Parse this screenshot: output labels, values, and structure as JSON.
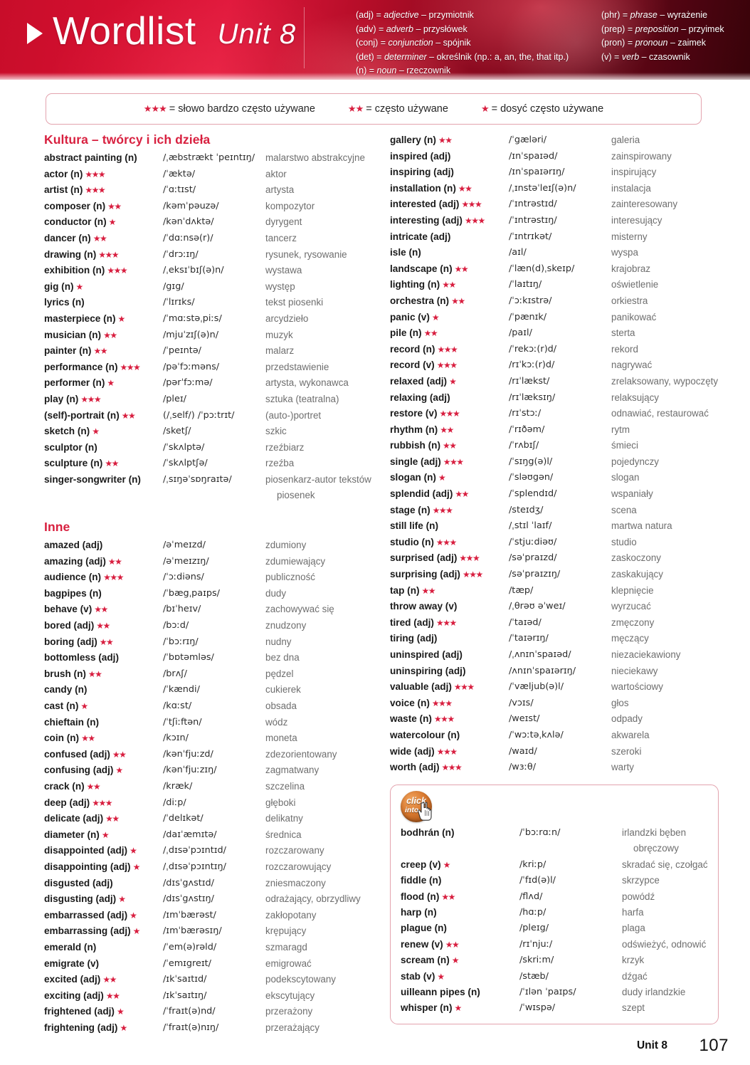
{
  "header": {
    "title": "Wordlist",
    "unit": "Unit 8",
    "arrow_icon": "triangle-right-icon",
    "abbreviations_left": [
      "(adj) = adjective – przymiotnik",
      "(adv) = adverb – przysłówek",
      "(conj) = conjunction – spójnik",
      "(det) = determiner – określnik (np.: a, an, the, that itp.)",
      "(n) = noun – rzeczownik"
    ],
    "abbreviations_right": [
      "(phr) = phrase – wyrażenie",
      "(prep) = preposition – przyimek",
      "(pron) = pronoun – zaimek",
      "(v) = verb – czasownik"
    ],
    "abbreviations_left_parts": [
      {
        "abbr": "(adj) = ",
        "italic": "adjective",
        "rest": " – przymiotnik"
      },
      {
        "abbr": "(adv) = ",
        "italic": "adverb",
        "rest": " – przysłówek"
      },
      {
        "abbr": "(conj) = ",
        "italic": "conjunction",
        "rest": " – spójnik"
      },
      {
        "abbr": "(det) = ",
        "italic": "determiner",
        "rest": " – określnik (np.: a, an, the, that itp.)"
      },
      {
        "abbr": "(n) = ",
        "italic": "noun",
        "rest": " – rzeczownik"
      }
    ],
    "abbreviations_right_parts": [
      {
        "abbr": "(phr) = ",
        "italic": "phrase",
        "rest": " – wyrażenie"
      },
      {
        "abbr": "(prep) = ",
        "italic": "preposition",
        "rest": " – przyimek"
      },
      {
        "abbr": "(pron) = ",
        "italic": "pronoun",
        "rest": " – zaimek"
      },
      {
        "abbr": "(v) = ",
        "italic": "verb",
        "rest": " – czasownik"
      }
    ]
  },
  "legend": {
    "items": [
      {
        "stars": "★★★",
        "text": "= słowo bardzo często używane"
      },
      {
        "stars": "★★",
        "text": "= często używane"
      },
      {
        "stars": "★",
        "text": "= dosyć często używane"
      }
    ]
  },
  "colors": {
    "accent_red": "#d8203f",
    "star_red": "#d81e3f",
    "header_red": "#c80d2a",
    "translation_grey": "#6e6e6e",
    "box_border": "#e3a3ae",
    "badge_orange": "#d9792f"
  },
  "sections": {
    "kultura": {
      "title": "Kultura – twórcy i ich dzieła",
      "entries": [
        {
          "word": "abstract painting (n)",
          "stars": "",
          "ipa": "/ˌæbstrækt ˈpeɪntɪŋ/",
          "pl": "malarstwo abstrakcyjne"
        },
        {
          "word": "actor (n)",
          "stars": "★★★",
          "ipa": "/ˈæktə/",
          "pl": "aktor"
        },
        {
          "word": "artist (n)",
          "stars": "★★★",
          "ipa": "/ˈɑːtɪst/",
          "pl": "artysta"
        },
        {
          "word": "composer (n)",
          "stars": "★★",
          "ipa": "/kəmˈpəuzə/",
          "pl": "kompozytor"
        },
        {
          "word": "conductor (n)",
          "stars": "★",
          "ipa": "/kənˈdʌktə/",
          "pl": "dyrygent"
        },
        {
          "word": "dancer (n)",
          "stars": "★★",
          "ipa": "/ˈdɑːnsə(r)/",
          "pl": "tancerz"
        },
        {
          "word": "drawing (n)",
          "stars": "★★★",
          "ipa": "/ˈdrɔːɪŋ/",
          "pl": "rysunek, rysowanie"
        },
        {
          "word": "exhibition (n)",
          "stars": "★★★",
          "ipa": "/ˌeksɪˈbɪʃ(ə)n/",
          "pl": "wystawa"
        },
        {
          "word": "gig (n)",
          "stars": "★",
          "ipa": "/gɪg/",
          "pl": "występ"
        },
        {
          "word": "lyrics (n)",
          "stars": "",
          "ipa": "/ˈlɪrɪks/",
          "pl": "tekst piosenki"
        },
        {
          "word": "masterpiece (n)",
          "stars": "★",
          "ipa": "/ˈmɑːstəˌpiːs/",
          "pl": "arcydzieło"
        },
        {
          "word": "musician (n)",
          "stars": "★★",
          "ipa": "/mjuˈzɪʃ(ə)n/",
          "pl": "muzyk"
        },
        {
          "word": "painter (n)",
          "stars": "★★",
          "ipa": "/ˈpeɪntə/",
          "pl": "malarz"
        },
        {
          "word": "performance (n)",
          "stars": "★★★",
          "ipa": "/pəˈfɔːməns/",
          "pl": "przedstawienie"
        },
        {
          "word": "performer (n)",
          "stars": "★",
          "ipa": "/pərˈfɔːmə/",
          "pl": "artysta, wykonawca"
        },
        {
          "word": "play (n)",
          "stars": "★★★",
          "ipa": "/pleɪ/",
          "pl": "sztuka (teatralna)"
        },
        {
          "word": "(self)-portrait (n)",
          "stars": "★★",
          "ipa": "(/ˌself/) /ˈpɔːtrɪt/",
          "pl": "(auto-)portret"
        },
        {
          "word": "sketch (n)",
          "stars": "★",
          "ipa": "/sketʃ/",
          "pl": "szkic"
        },
        {
          "word": "sculptor (n)",
          "stars": "",
          "ipa": "/ˈskʌlptə/",
          "pl": "rzeźbiarz"
        },
        {
          "word": "sculpture (n)",
          "stars": "★★",
          "ipa": "/ˈskʌlptʃə/",
          "pl": "rzeźba"
        },
        {
          "word": "singer-songwriter (n)",
          "stars": "",
          "ipa": "/ˌsɪŋəˈsɒŋraɪtə/",
          "pl": "piosenkarz-autor tekstów",
          "pl2": "piosenek"
        }
      ]
    },
    "inne": {
      "title": "Inne",
      "entries": [
        {
          "word": "amazed (adj)",
          "stars": "",
          "ipa": "/əˈmeɪzd/",
          "pl": "zdumiony"
        },
        {
          "word": "amazing (adj)",
          "stars": "★★",
          "ipa": "/əˈmeɪzɪŋ/",
          "pl": "zdumiewający"
        },
        {
          "word": "audience (n)",
          "stars": "★★★",
          "ipa": "/ˈɔːdiəns/",
          "pl": "publiczność"
        },
        {
          "word": "bagpipes (n)",
          "stars": "",
          "ipa": "/ˈbægˌpaɪps/",
          "pl": "dudy"
        },
        {
          "word": "behave (v)",
          "stars": "★★",
          "ipa": "/bɪˈheɪv/",
          "pl": "zachowywać się"
        },
        {
          "word": "bored (adj)",
          "stars": "★★",
          "ipa": "/bɔːd/",
          "pl": "znudzony"
        },
        {
          "word": "boring (adj)",
          "stars": "★★",
          "ipa": "/ˈbɔːrɪŋ/",
          "pl": "nudny"
        },
        {
          "word": "bottomless (adj)",
          "stars": "",
          "ipa": "/ˈbɒtəmləs/",
          "pl": "bez dna"
        },
        {
          "word": "brush (n)",
          "stars": "★★",
          "ipa": "/brʌʃ/",
          "pl": "pędzel"
        },
        {
          "word": "candy (n)",
          "stars": "",
          "ipa": "/ˈkændi/",
          "pl": "cukierek"
        },
        {
          "word": "cast (n)",
          "stars": "★",
          "ipa": "/kɑːst/",
          "pl": "obsada"
        },
        {
          "word": "chieftain (n)",
          "stars": "",
          "ipa": "/ˈtʃiːftən/",
          "pl": "wódz"
        },
        {
          "word": "coin (n)",
          "stars": "★★",
          "ipa": "/kɔɪn/",
          "pl": "moneta"
        },
        {
          "word": "confused (adj)",
          "stars": "★★",
          "ipa": "/kənˈfjuːzd/",
          "pl": "zdezorientowany"
        },
        {
          "word": "confusing (adj)",
          "stars": "★",
          "ipa": "/kənˈfjuːzɪŋ/",
          "pl": "zagmatwany"
        },
        {
          "word": "crack (n)",
          "stars": "★★",
          "ipa": "/kræk/",
          "pl": "szczelina"
        },
        {
          "word": "deep (adj)",
          "stars": "★★★",
          "ipa": "/diːp/",
          "pl": "głęboki"
        },
        {
          "word": "delicate (adj)",
          "stars": "★★",
          "ipa": "/ˈdelɪkət/",
          "pl": "delikatny"
        },
        {
          "word": "diameter (n)",
          "stars": "★",
          "ipa": "/daɪˈæmɪtə/",
          "pl": "średnica"
        },
        {
          "word": "disappointed (adj)",
          "stars": "★",
          "ipa": "/ˌdɪsəˈpɔɪntɪd/",
          "pl": "rozczarowany"
        },
        {
          "word": "disappointing (adj)",
          "stars": "★",
          "ipa": "/ˌdɪsəˈpɔɪntɪŋ/",
          "pl": "rozczarowujący"
        },
        {
          "word": "disgusted (adj)",
          "stars": "",
          "ipa": "/dɪsˈgʌstɪd/",
          "pl": "zniesmaczony"
        },
        {
          "word": "disgusting (adj)",
          "stars": "★",
          "ipa": "/dɪsˈgʌstɪŋ/",
          "pl": "odrażający, obrzydliwy"
        },
        {
          "word": "embarrassed (adj)",
          "stars": "★",
          "ipa": "/ɪmˈbærəst/",
          "pl": "zakłopotany"
        },
        {
          "word": "embarrassing (adj)",
          "stars": "★",
          "ipa": "/ɪmˈbærəsɪŋ/",
          "pl": "krępujący"
        },
        {
          "word": "emerald (n)",
          "stars": "",
          "ipa": "/ˈem(ə)rəld/",
          "pl": "szmaragd"
        },
        {
          "word": "emigrate (v)",
          "stars": "",
          "ipa": "/ˈemɪgreɪt/",
          "pl": "emigrować"
        },
        {
          "word": "excited (adj)",
          "stars": "★★",
          "ipa": "/ɪkˈsaɪtɪd/",
          "pl": "podekscytowany"
        },
        {
          "word": "exciting (adj)",
          "stars": "★★",
          "ipa": "/ɪkˈsaɪtɪŋ/",
          "pl": "ekscytujący"
        },
        {
          "word": "frightened (adj)",
          "stars": "★",
          "ipa": "/ˈfraɪt(ə)nd/",
          "pl": "przerażony"
        },
        {
          "word": "frightening (adj)",
          "stars": "★",
          "ipa": "/ˈfraɪt(ə)nɪŋ/",
          "pl": "przerażający"
        }
      ]
    },
    "inne_continued": {
      "entries": [
        {
          "word": "gallery (n)",
          "stars": "★★",
          "ipa": "/ˈgæləri/",
          "pl": "galeria"
        },
        {
          "word": "inspired (adj)",
          "stars": "",
          "ipa": "/ɪnˈspaɪəd/",
          "pl": "zainspirowany"
        },
        {
          "word": "inspiring (adj)",
          "stars": "",
          "ipa": "/ɪnˈspaɪərɪŋ/",
          "pl": "inspirujący"
        },
        {
          "word": "installation (n)",
          "stars": "★★",
          "ipa": "/ˌɪnstəˈleɪʃ(ə)n/",
          "pl": "instalacja"
        },
        {
          "word": "interested (adj)",
          "stars": "★★★",
          "ipa": "/ˈɪntrəstɪd/",
          "pl": "zainteresowany"
        },
        {
          "word": "interesting (adj)",
          "stars": "★★★",
          "ipa": "/ˈɪntrəstɪŋ/",
          "pl": "interesujący"
        },
        {
          "word": "intricate (adj)",
          "stars": "",
          "ipa": "/ˈɪntrɪkət/",
          "pl": "misterny"
        },
        {
          "word": "isle (n)",
          "stars": "",
          "ipa": "/aɪl/",
          "pl": "wyspa"
        },
        {
          "word": "landscape (n)",
          "stars": "★★",
          "ipa": "/ˈlæn(d)ˌskeɪp/",
          "pl": "krajobraz"
        },
        {
          "word": "lighting (n)",
          "stars": "★★",
          "ipa": "/ˈlaɪtɪŋ/",
          "pl": "oświetlenie"
        },
        {
          "word": "orchestra (n)",
          "stars": "★★",
          "ipa": "/ˈɔːkɪstrə/",
          "pl": "orkiestra"
        },
        {
          "word": "panic (v)",
          "stars": "★",
          "ipa": "/ˈpænɪk/",
          "pl": "panikować"
        },
        {
          "word": "pile (n)",
          "stars": "★★",
          "ipa": "/paɪl/",
          "pl": "sterta"
        },
        {
          "word": "record (n)",
          "stars": "★★★",
          "ipa": "/ˈrekɔː(r)d/",
          "pl": "rekord"
        },
        {
          "word": "record (v)",
          "stars": "★★★",
          "ipa": "/rɪˈkɔː(r)d/",
          "pl": "nagrywać"
        },
        {
          "word": "relaxed (adj)",
          "stars": "★",
          "ipa": "/rɪˈlækst/",
          "pl": "zrelaksowany, wypoczęty"
        },
        {
          "word": "relaxing (adj)",
          "stars": "",
          "ipa": "/rɪˈlæksɪŋ/",
          "pl": "relaksujący"
        },
        {
          "word": "restore (v)",
          "stars": "★★★",
          "ipa": "/rɪˈstɔː/",
          "pl": "odnawiać, restaurować"
        },
        {
          "word": "rhythm (n)",
          "stars": "★★",
          "ipa": "/ˈrɪðəm/",
          "pl": "rytm"
        },
        {
          "word": "rubbish (n)",
          "stars": "★★",
          "ipa": "/ˈrʌbɪʃ/",
          "pl": "śmieci"
        },
        {
          "word": "single (adj)",
          "stars": "★★★",
          "ipa": "/ˈsɪŋg(ə)l/",
          "pl": "pojedynczy"
        },
        {
          "word": "slogan (n)",
          "stars": "★",
          "ipa": "/ˈsləʊgən/",
          "pl": "slogan"
        },
        {
          "word": "splendid (adj)",
          "stars": "★★",
          "ipa": "/ˈsplendɪd/",
          "pl": "wspaniały"
        },
        {
          "word": "stage (n)",
          "stars": "★★★",
          "ipa": "/steɪdʒ/",
          "pl": "scena"
        },
        {
          "word": "still life (n)",
          "stars": "",
          "ipa": "/ˌstɪl ˈlaɪf/",
          "pl": "martwa natura"
        },
        {
          "word": "studio (n)",
          "stars": "★★★",
          "ipa": "/ˈstjuːdiəʊ/",
          "pl": "studio"
        },
        {
          "word": "surprised (adj)",
          "stars": "★★★",
          "ipa": "/səˈpraɪzd/",
          "pl": "zaskoczony"
        },
        {
          "word": "surprising (adj)",
          "stars": "★★★",
          "ipa": "/səˈpraɪzɪŋ/",
          "pl": "zaskakujący"
        },
        {
          "word": "tap (n)",
          "stars": "★★",
          "ipa": "/tæp/",
          "pl": "klepnięcie"
        },
        {
          "word": "throw away (v)",
          "stars": "",
          "ipa": "/ˌθrəʊ əˈweɪ/",
          "pl": "wyrzucać"
        },
        {
          "word": "tired (adj)",
          "stars": "★★★",
          "ipa": "/ˈtaɪəd/",
          "pl": "zmęczony"
        },
        {
          "word": "tiring (adj)",
          "stars": "",
          "ipa": "/ˈtaɪərɪŋ/",
          "pl": "męczący"
        },
        {
          "word": "uninspired (adj)",
          "stars": "",
          "ipa": "/ˌʌnɪnˈspaɪəd/",
          "pl": "niezaciekawiony"
        },
        {
          "word": "uninspiring (adj)",
          "stars": "",
          "ipa": "/ʌnɪnˈspaɪərɪŋ/",
          "pl": "nieciekawy"
        },
        {
          "word": "valuable (adj)",
          "stars": "★★★",
          "ipa": "/ˈvæljub(ə)l/",
          "pl": "wartościowy"
        },
        {
          "word": "voice (n)",
          "stars": "★★★",
          "ipa": "/vɔɪs/",
          "pl": "głos"
        },
        {
          "word": "waste (n)",
          "stars": "★★★",
          "ipa": "/weɪst/",
          "pl": "odpady"
        },
        {
          "word": "watercolour (n)",
          "stars": "",
          "ipa": "/ˈwɔːtəˌkʌlə/",
          "pl": "akwarela"
        },
        {
          "word": "wide (adj)",
          "stars": "★★★",
          "ipa": "/waɪd/",
          "pl": "szeroki"
        },
        {
          "word": "worth (adj)",
          "stars": "★★★",
          "ipa": "/wɜːθ/",
          "pl": "warty"
        }
      ]
    },
    "click_into": {
      "badge_line1": "click",
      "badge_line2": "into...",
      "badge_icon": "hand-pointer-icon",
      "entries": [
        {
          "word": "bodhrán (n)",
          "stars": "",
          "ipa": "/ˈbɔːrɑːn/",
          "pl": "irlandzki bęben",
          "pl2": "obręczowy"
        },
        {
          "word": "creep (v)",
          "stars": "★",
          "ipa": "/kriːp/",
          "pl": "skradać się, czołgać"
        },
        {
          "word": "fiddle (n)",
          "stars": "",
          "ipa": "/ˈfɪd(ə)l/",
          "pl": "skrzypce"
        },
        {
          "word": "flood (n)",
          "stars": "★★",
          "ipa": "/flʌd/",
          "pl": "powódź"
        },
        {
          "word": "harp (n)",
          "stars": "",
          "ipa": "/hɑːp/",
          "pl": "harfa"
        },
        {
          "word": "plague (n)",
          "stars": "",
          "ipa": "/pleɪg/",
          "pl": "plaga"
        },
        {
          "word": "renew (v)",
          "stars": "★★",
          "ipa": "/rɪˈnjuː/",
          "pl": "odświeżyć, odnowić"
        },
        {
          "word": "scream (n)",
          "stars": "★",
          "ipa": "/skriːm/",
          "pl": "krzyk"
        },
        {
          "word": "stab (v)",
          "stars": "★",
          "ipa": "/stæb/",
          "pl": "dźgać"
        },
        {
          "word": "uilleann pipes (n)",
          "stars": "",
          "ipa": "/ˈɪlən ˈpaɪps/",
          "pl": "dudy irlandzkie"
        },
        {
          "word": "whisper (n)",
          "stars": "★",
          "ipa": "/ˈwɪspə/",
          "pl": "szept"
        }
      ]
    }
  },
  "footer": {
    "unit": "Unit 8",
    "page": "107"
  }
}
